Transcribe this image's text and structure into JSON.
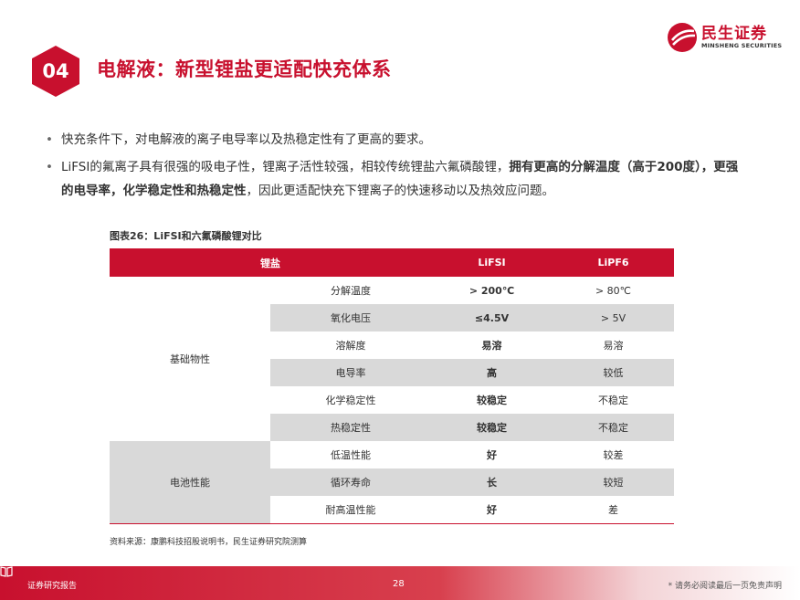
{
  "header": {
    "section_number": "04",
    "title": "电解液：新型锂盐更适配快充体系"
  },
  "logo": {
    "name_cn": "民生证券",
    "name_en": "MINSHENG SECURITIES"
  },
  "bullets": [
    {
      "parts": [
        {
          "text": "快充条件下，对电解液的离子电导率以及热稳定性有了更高的要求。",
          "bold": false
        }
      ]
    },
    {
      "parts": [
        {
          "text": "LiFSI的氟离子具有很强的吸电子性，锂离子活性较强，相较传统锂盐六氟磷酸锂，",
          "bold": false
        },
        {
          "text": "拥有更高的分解温度（高于200度），更强的电导率，化学稳定性和热稳定性",
          "bold": true
        },
        {
          "text": "，因此更适配快充下锂离子的快速移动以及热效应问题。",
          "bold": false
        }
      ]
    }
  ],
  "table": {
    "caption": "图表26：LiFSI和六氟磷酸锂对比",
    "headers": [
      "锂盐",
      "LiFSI",
      "LiPF6"
    ],
    "groups": [
      "基础物性",
      "电池性能"
    ],
    "rows": [
      [
        "分解温度",
        "> 200℃",
        "> 80℃"
      ],
      [
        "氧化电压",
        "≤4.5V",
        "> 5V"
      ],
      [
        "溶解度",
        "易溶",
        "易溶"
      ],
      [
        "电导率",
        "高",
        "较低"
      ],
      [
        "化学稳定性",
        "较稳定",
        "不稳定"
      ],
      [
        "热稳定性",
        "较稳定",
        "不稳定"
      ],
      [
        "低温性能",
        "好",
        "较差"
      ],
      [
        "循环寿命",
        "长",
        "较短"
      ],
      [
        "耐高温性能",
        "好",
        "差"
      ]
    ],
    "source": "资料来源：康鹏科技招股说明书，民生证券研究院测算"
  },
  "footer": {
    "left_label": "证券研究报告",
    "page_number": "28",
    "disclaimer": "* 请务必阅读最后一页免责声明"
  },
  "colors": {
    "brand_red": "#c8102e",
    "row_grey": "#d9d9d9"
  }
}
